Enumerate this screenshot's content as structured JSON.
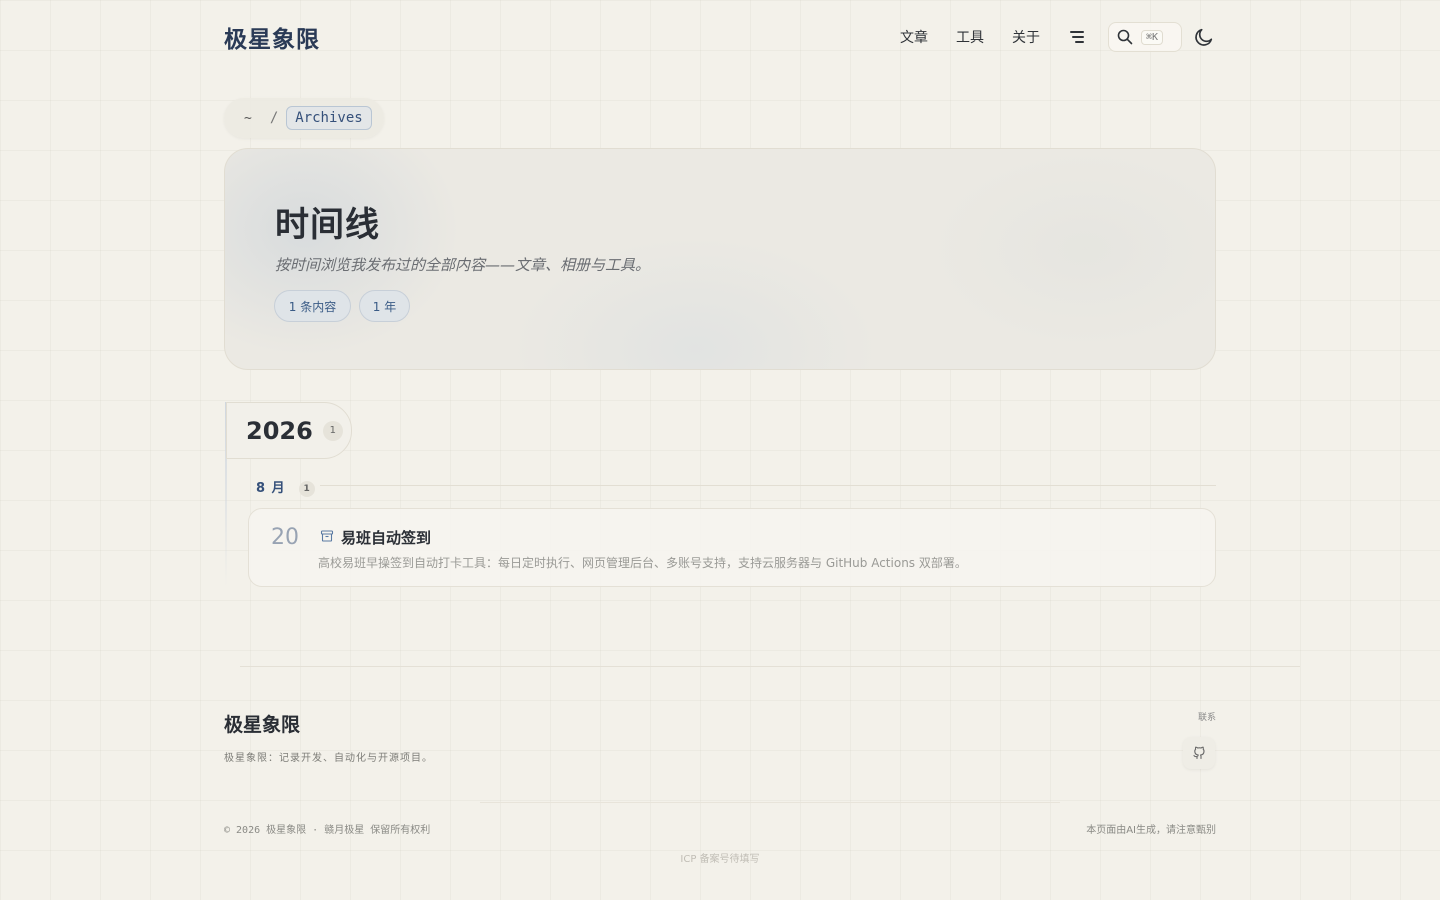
{
  "header": {
    "logo": "极星象限",
    "nav": [
      {
        "label": "文章"
      },
      {
        "label": "工具"
      },
      {
        "label": "关于"
      }
    ],
    "search_shortcut": "⌘K",
    "icons": [
      "menu-icon",
      "search-icon",
      "moon-icon"
    ]
  },
  "breadcrumb": {
    "home": "~",
    "separator": "/",
    "current": "Archives"
  },
  "hero": {
    "title": "时间线",
    "subtitle": "按时间浏览我发布过的全部内容——文章、相册与工具。",
    "chips": [
      "1 条内容",
      "1 年"
    ]
  },
  "timeline": {
    "year": "2026",
    "year_count": "1",
    "month": "8 月",
    "month_count": "1",
    "posts": [
      {
        "day": "20",
        "title": "易班自动签到",
        "description": "高校易班早操签到自动打卡工具：每日定时执行、网页管理后台、多账号支持，支持云服务器与 GitHub Actions 双部署。",
        "icon": "archive-box-icon"
      }
    ]
  },
  "footer": {
    "logo": "极星象限",
    "description": "极星象限：记录开发、自动化与开源项目。",
    "contact_label": "联系",
    "contact_icon": "github-icon",
    "copyright": "© 2026 极星象限 · 赣月极星 保留所有权利",
    "ai_note": "本页面由AI生成，请注意甄别",
    "icp": "ICP 备案号待填写"
  },
  "colors": {
    "background": "#f3f1ea",
    "accent": "#35507a",
    "text": "#2b2f36"
  }
}
